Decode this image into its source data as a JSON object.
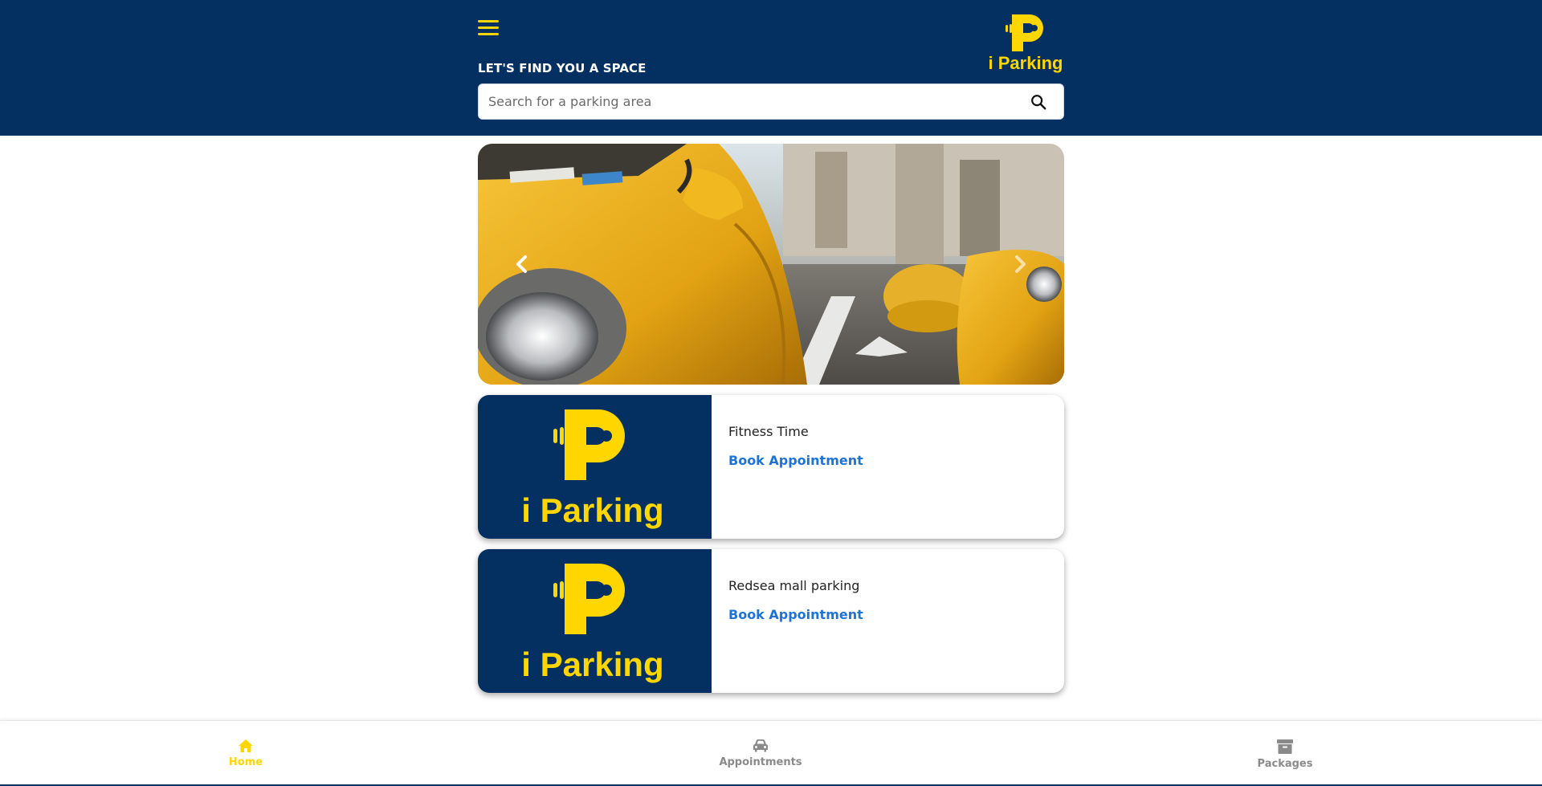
{
  "header": {
    "title": "LET'S FIND YOU A SPACE",
    "menu_icon": "hamburger-menu-icon",
    "logo_text": "i Parking"
  },
  "search": {
    "placeholder": "Search for a parking area",
    "value": "",
    "icon": "search-icon"
  },
  "carousel": {
    "image_description": "yellow taxis",
    "prev_icon": "chevron-left-icon",
    "next_icon": "chevron-right-icon"
  },
  "cards": [
    {
      "logo_text": "i Parking",
      "title": "Fitness Time",
      "action_label": "Book Appointment"
    },
    {
      "logo_text": "i Parking",
      "title": "Redsea mall parking",
      "action_label": "Book Appointment"
    }
  ],
  "bottom_nav": [
    {
      "label": "Home",
      "icon": "home-icon",
      "active": true
    },
    {
      "label": "Appointments",
      "icon": "car-icon",
      "active": false
    },
    {
      "label": "Packages",
      "icon": "archive-box-icon",
      "active": false
    }
  ],
  "colors": {
    "brand_navy": "#043061",
    "brand_yellow": "#FFD600",
    "link_blue": "#1f73d6",
    "inactive_gray": "#8a8a8a"
  }
}
